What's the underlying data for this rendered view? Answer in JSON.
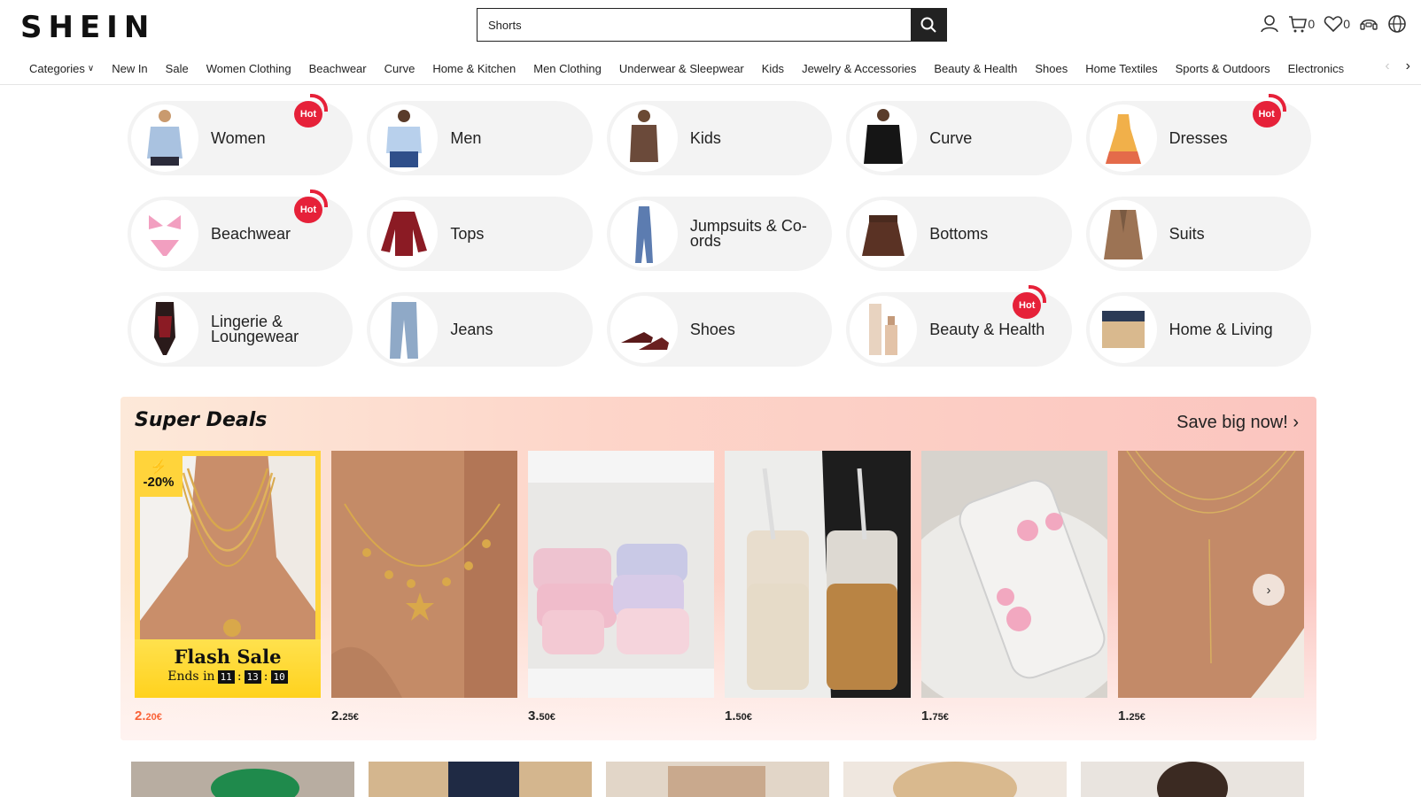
{
  "header": {
    "logo": "SHEIN",
    "search_value": "Shorts",
    "cart_count": "0",
    "wishlist_count": "0"
  },
  "nav": {
    "items": [
      "Categories",
      "New In",
      "Sale",
      "Women Clothing",
      "Beachwear",
      "Curve",
      "Home & Kitchen",
      "Men Clothing",
      "Underwear & Sleepwear",
      "Kids",
      "Jewelry & Accessories",
      "Beauty & Health",
      "Shoes",
      "Home Textiles",
      "Sports & Outdoors",
      "Electronics"
    ]
  },
  "categories": {
    "hot_label": "Hot",
    "rows": [
      [
        {
          "label": "Women",
          "hot": true,
          "icon": "shirt-woman"
        },
        {
          "label": "Men",
          "hot": false,
          "icon": "shirt-man"
        },
        {
          "label": "Kids",
          "hot": false,
          "icon": "kid-outfit"
        },
        {
          "label": "Curve",
          "hot": false,
          "icon": "black-dress"
        },
        {
          "label": "Dresses",
          "hot": true,
          "icon": "dress"
        }
      ],
      [
        {
          "label": "Beachwear",
          "hot": true,
          "icon": "bikini"
        },
        {
          "label": "Tops",
          "hot": false,
          "icon": "red-top"
        },
        {
          "label": "Jumpsuits & Co-ords",
          "hot": false,
          "icon": "jumpsuit"
        },
        {
          "label": "Bottoms",
          "hot": false,
          "icon": "skirt"
        },
        {
          "label": "Suits",
          "hot": false,
          "icon": "blazer"
        }
      ],
      [
        {
          "label": "Lingerie & Loungewear",
          "hot": false,
          "icon": "bodysuit"
        },
        {
          "label": "Jeans",
          "hot": false,
          "icon": "jeans"
        },
        {
          "label": "Shoes",
          "hot": false,
          "icon": "heels"
        },
        {
          "label": "Beauty & Health",
          "hot": true,
          "icon": "cosmetics"
        },
        {
          "label": "Home & Living",
          "hot": false,
          "icon": "storage-box"
        }
      ]
    ]
  },
  "deals": {
    "logo_text": "Super Deals",
    "save_text": "Save big now!",
    "flash": {
      "discount": "-20%",
      "title": "Flash Sale",
      "ends_in": "Ends in",
      "hours": "11",
      "minutes": "13",
      "seconds": "10"
    },
    "products": [
      {
        "name": "layered gold necklace",
        "price_main": "2.",
        "price_small": "20€"
      },
      {
        "name": "starfish charm necklace",
        "price_main": "2.",
        "price_small": "25€"
      },
      {
        "name": "floral cosmetic bags",
        "price_main": "3.",
        "price_small": "50€"
      },
      {
        "name": "ribbed glass cups",
        "price_main": "1.",
        "price_small": "50€"
      },
      {
        "name": "floral phone case",
        "price_main": "1.",
        "price_small": "75€"
      },
      {
        "name": "y drop necklace",
        "price_main": "1.",
        "price_small": "25€"
      }
    ]
  },
  "colors": {
    "accent_red": "#e62139",
    "price_orange": "#fa6338",
    "flash_yellow": "#ffd43b"
  }
}
